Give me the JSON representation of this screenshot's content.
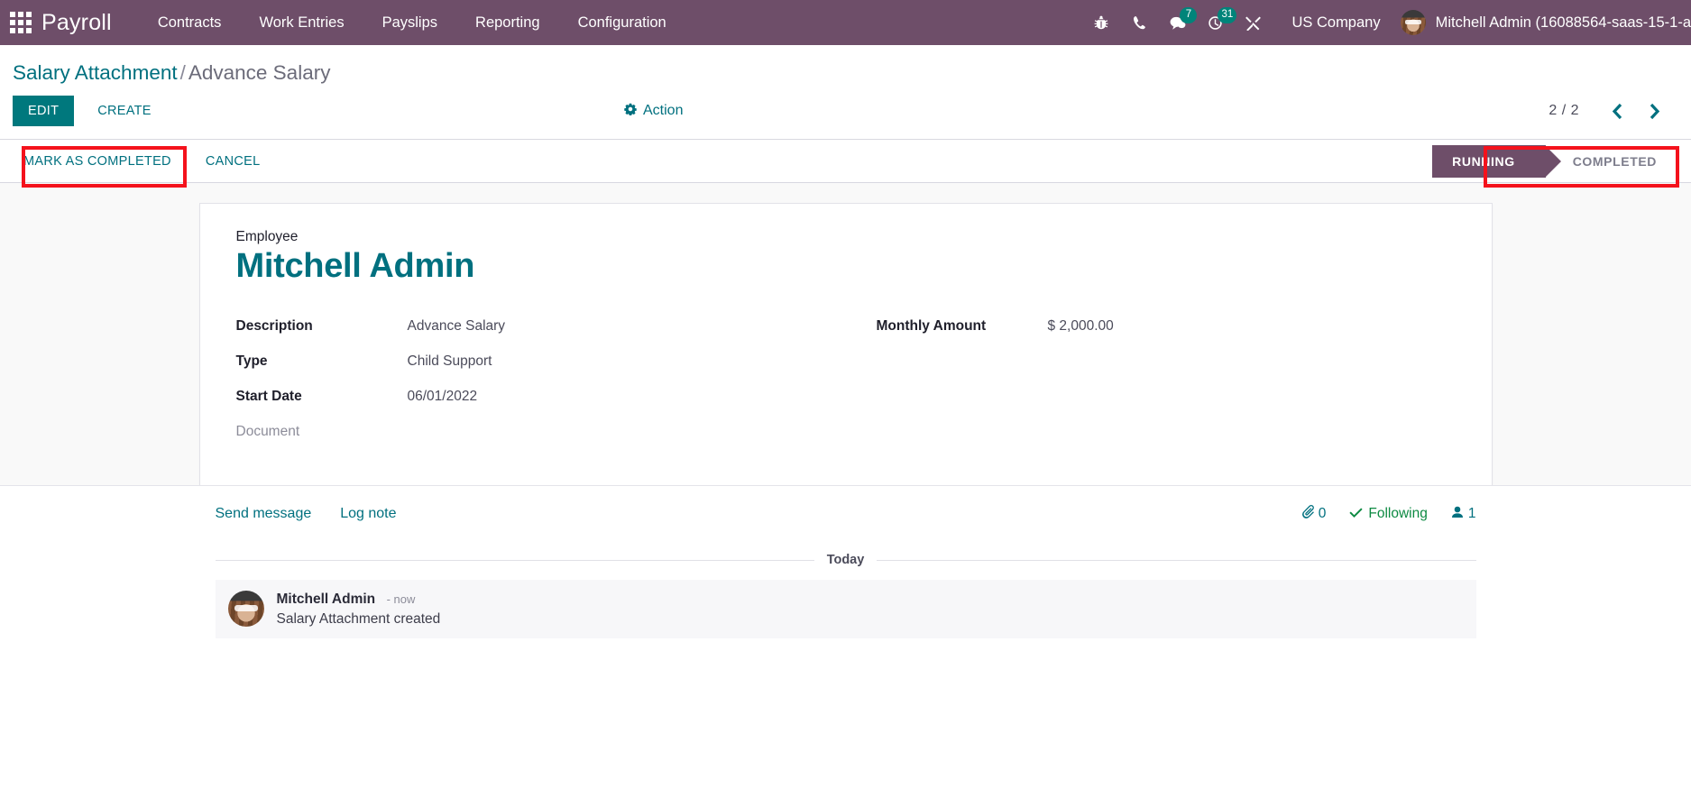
{
  "navbar": {
    "brand": "Payroll",
    "menu": [
      {
        "label": "Contracts"
      },
      {
        "label": "Work Entries"
      },
      {
        "label": "Payslips"
      },
      {
        "label": "Reporting"
      },
      {
        "label": "Configuration"
      }
    ],
    "icons": [
      {
        "name": "bug-icon"
      },
      {
        "name": "phone-icon"
      },
      {
        "name": "messages-icon",
        "badge": "7"
      },
      {
        "name": "activities-icon",
        "badge": "31"
      },
      {
        "name": "tools-icon"
      }
    ],
    "company": "US Company",
    "user": "Mitchell Admin (16088564-saas-15-1-a",
    "bg_color": "#6e4e69",
    "badge_color": "#00847a"
  },
  "breadcrumb": {
    "parent": "Salary Attachment",
    "separator": "/",
    "current": "Advance Salary"
  },
  "controls": {
    "edit": "EDIT",
    "create": "CREATE",
    "action": "Action",
    "pager_count": "2 / 2",
    "prev": "‹",
    "next": "›",
    "edit_color": "#00787d",
    "link_color": "#00707f"
  },
  "statusbar": {
    "buttons": [
      {
        "label": "MARK AS COMPLETED",
        "highlighted": true
      },
      {
        "label": "CANCEL",
        "highlighted": false
      }
    ],
    "states": [
      {
        "label": "RUNNING",
        "active": true
      },
      {
        "label": "COMPLETED",
        "active": false
      }
    ],
    "highlight_color": "#f4121c",
    "active_pill_color": "#6e4e69"
  },
  "form": {
    "employee_label": "Employee",
    "employee_name": "Mitchell Admin",
    "left_fields": [
      {
        "label": "Description",
        "value": "Advance Salary",
        "muted": false
      },
      {
        "label": "Type",
        "value": "Child Support",
        "muted": false
      },
      {
        "label": "Start Date",
        "value": "06/01/2022",
        "muted": false
      },
      {
        "label": "Document",
        "value": "",
        "muted": true
      }
    ],
    "right_fields": [
      {
        "label": "Monthly Amount",
        "value": "$ 2,000.00",
        "muted": false
      }
    ]
  },
  "chatter": {
    "send_message": "Send message",
    "log_note": "Log note",
    "attachment_count": "0",
    "following": "Following",
    "followers_count": "1",
    "day_separator": "Today",
    "messages": [
      {
        "author": "Mitchell Admin",
        "time": "- now",
        "text": "Salary Attachment created"
      }
    ]
  }
}
